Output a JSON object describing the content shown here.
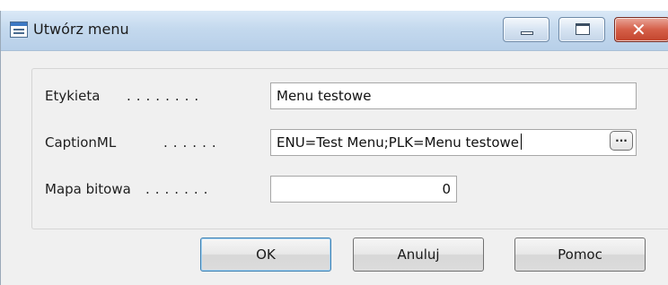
{
  "window": {
    "title": "Utwórz menu",
    "icon": "window-table-icon",
    "controls": {
      "minimize_icon": "minimize-icon",
      "maximize_icon": "maximize-icon",
      "close_icon": "close-icon",
      "close_glyph": "✕",
      "close_color": "#c2442d"
    }
  },
  "form": {
    "fields": [
      {
        "label": "Etykieta",
        "value": "Menu testowe"
      },
      {
        "label": "CaptionML",
        "value": "ENU=Test Menu;PLK=Menu testowe",
        "assist_label": "..."
      },
      {
        "label": "Mapa bitowa",
        "value": "0"
      }
    ]
  },
  "buttons": {
    "ok": "OK",
    "cancel": "Anuluj",
    "help": "Pomoc"
  }
}
